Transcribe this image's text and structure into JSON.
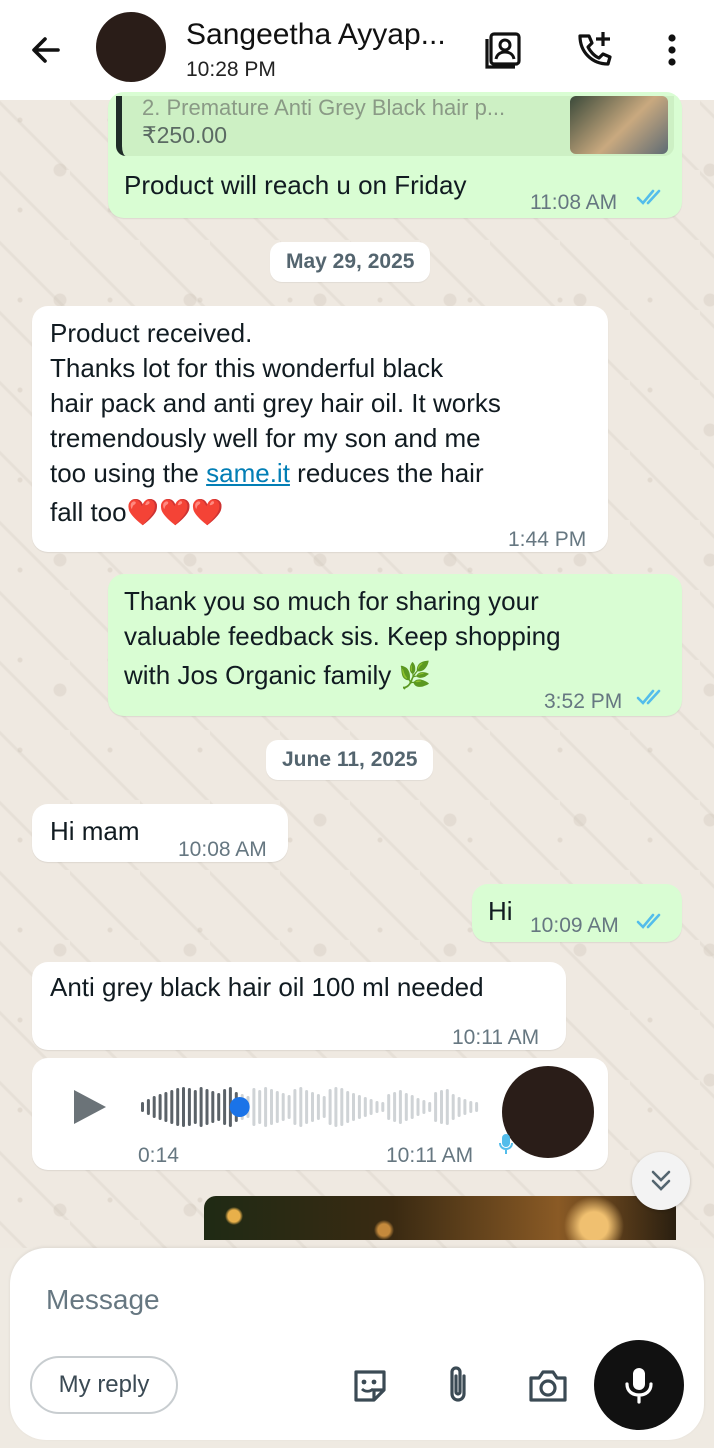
{
  "header": {
    "contact_name": "Sangeetha Ayyap...",
    "last_seen": "10:28 PM"
  },
  "messages": {
    "m0": {
      "quoted_title": "2. Premature Anti Grey Black hair p...",
      "quoted_price": "₹250.00",
      "text": "Product will reach u on Friday",
      "time": "11:08 AM"
    },
    "date1": "May 29, 2025",
    "m1": {
      "line1": "Product  received.",
      "line2": "Thanks lot for this wonderful black",
      "line3": "hair pack and anti grey hair oil. It works",
      "line4": "tremendously well for my son and me",
      "line5_pre": "too using the ",
      "line5_link": "same.it",
      "line5_post": " reduces the hair",
      "line6": "fall too❤️❤️❤️",
      "time": "1:44 PM"
    },
    "m2": {
      "line1": "Thank you so much for sharing your",
      "line2": "valuable feedback sis. Keep shopping",
      "line3": "with Jos Organic family 🌿",
      "time": "3:52 PM"
    },
    "date2": "June 11, 2025",
    "m3": {
      "text": "Hi mam",
      "time": "10:08 AM"
    },
    "m4": {
      "text": "Hi",
      "time": "10:09 AM"
    },
    "m5": {
      "text": "Anti  grey black hair oil 100 ml needed",
      "time": "10:11 AM"
    },
    "m6": {
      "duration": "0:14",
      "time": "10:11 AM",
      "progress": 0.29
    }
  },
  "composer": {
    "placeholder": "Message",
    "reply_chip": "My reply"
  },
  "colors": {
    "outgoing": "#d9fdd3",
    "incoming": "#ffffff",
    "tick_blue": "#53bdeb",
    "voice_dot": "#1a73e8"
  },
  "icons": [
    "back-arrow-icon",
    "contact-card-icon",
    "add-call-icon",
    "more-options-icon",
    "play-icon",
    "sticker-icon",
    "attach-icon",
    "camera-icon",
    "mic-icon",
    "double-chevron-down-icon",
    "read-ticks-icon"
  ]
}
